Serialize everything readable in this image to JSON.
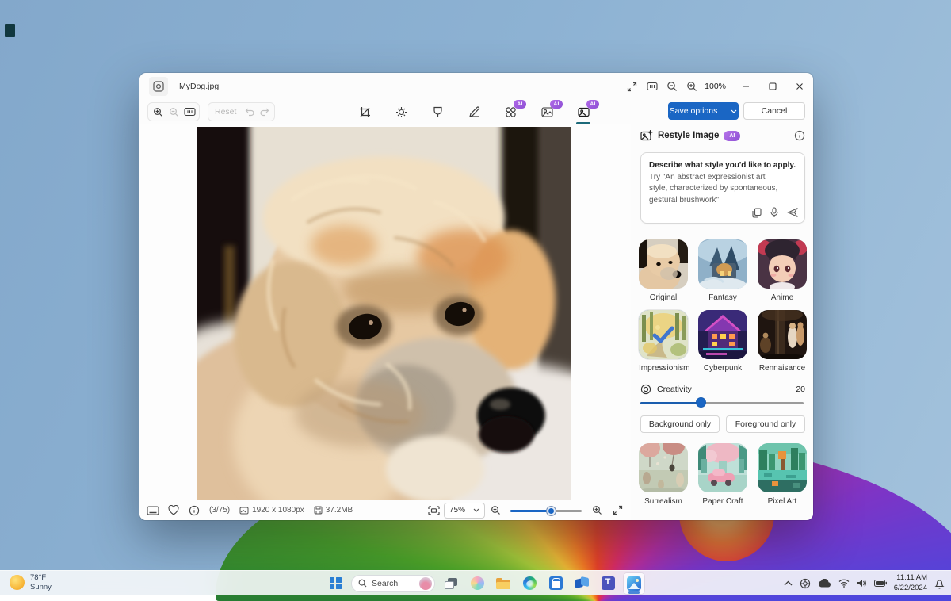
{
  "desktop": {
    "weather": {
      "temperature": "78°F",
      "condition": "Sunny"
    },
    "taskbar": {
      "search_placeholder": "Search",
      "clock_time": "11:11 AM",
      "clock_date": "6/22/2024"
    }
  },
  "window": {
    "title": "MyDog.jpg",
    "zoom_level": "100%",
    "toolbar": {
      "reset": "Reset"
    },
    "footer": {
      "photo_index": "(3/75)",
      "dimensions": "1920 x 1080px",
      "file_size": "37.2MB",
      "zoom": "75%"
    },
    "panel": {
      "save_options": "Save options",
      "cancel": "Cancel",
      "title": "Restyle Image",
      "ai_badge": "AI",
      "prompt": {
        "heading": "Describe what style you'd like to apply.",
        "suggestion": "Try \"An abstract expressionist art style, characterized by spontaneous, gestural brushwork\""
      },
      "styles": [
        {
          "label": "Original",
          "selected": false
        },
        {
          "label": "Fantasy",
          "selected": false
        },
        {
          "label": "Anime",
          "selected": false
        },
        {
          "label": "Impressionism",
          "selected": true
        },
        {
          "label": "Cyberpunk",
          "selected": false
        },
        {
          "label": "Rennaisance",
          "selected": false
        },
        {
          "label": "Surrealism",
          "selected": false
        },
        {
          "label": "Paper Craft",
          "selected": false
        },
        {
          "label": "Pixel Art",
          "selected": false
        }
      ],
      "creativity": {
        "label": "Creativity",
        "value": "20"
      },
      "scope_buttons": {
        "background": "Background only",
        "foreground": "Foreground only"
      }
    }
  },
  "colors": {
    "accent_blue": "#1a66c4",
    "ai_badge_purple": "#8d4fd4",
    "restyle_underline_teal": "#1d6a7a",
    "selected_style_border": "#2e6bd6"
  }
}
